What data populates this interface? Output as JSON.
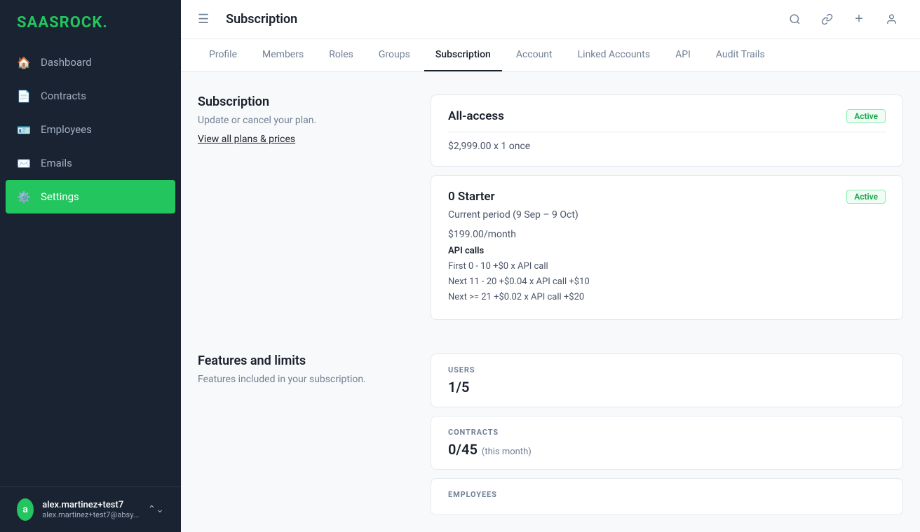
{
  "app": {
    "logo_text": "SAASROCK",
    "logo_dot": "."
  },
  "sidebar": {
    "items": [
      {
        "id": "dashboard",
        "label": "Dashboard",
        "icon": "🏠",
        "active": false
      },
      {
        "id": "contracts",
        "label": "Contracts",
        "icon": "📄",
        "active": false
      },
      {
        "id": "employees",
        "label": "Employees",
        "icon": "🪪",
        "active": false
      },
      {
        "id": "emails",
        "label": "Emails",
        "icon": "✉️",
        "active": false
      },
      {
        "id": "settings",
        "label": "Settings",
        "icon": "⚙️",
        "active": true
      }
    ],
    "user": {
      "avatar_letter": "a",
      "name": "alex.martinez+test7",
      "email": "alex.martinez+test7@absy..."
    }
  },
  "topbar": {
    "title": "Subscription",
    "search_icon": "🔍",
    "link_icon": "🔗",
    "add_icon": "+",
    "user_icon": "👤"
  },
  "tabs": [
    {
      "id": "profile",
      "label": "Profile",
      "active": false
    },
    {
      "id": "members",
      "label": "Members",
      "active": false
    },
    {
      "id": "roles",
      "label": "Roles",
      "active": false
    },
    {
      "id": "groups",
      "label": "Groups",
      "active": false
    },
    {
      "id": "subscription",
      "label": "Subscription",
      "active": true
    },
    {
      "id": "account",
      "label": "Account",
      "active": false
    },
    {
      "id": "linked-accounts",
      "label": "Linked Accounts",
      "active": false
    },
    {
      "id": "api",
      "label": "API",
      "active": false
    },
    {
      "id": "audit-trails",
      "label": "Audit Trails",
      "active": false
    }
  ],
  "subscription_section": {
    "heading": "Subscription",
    "description": "Update or cancel your plan.",
    "link_text": "View all plans & prices",
    "plans": [
      {
        "id": "all-access",
        "name": "All-access",
        "badge": "Active",
        "price_line": "$2,999.00 x 1 once"
      },
      {
        "id": "starter",
        "name": "0 Starter",
        "badge": "Active",
        "period": "Current period (9 Sep – 9 Oct)",
        "monthly": "$199.00/month",
        "api_calls_label": "API calls",
        "api_lines": [
          "First 0 - 10 +$0 x API call",
          "Next 11 - 20 +$0.04 x API call +$10",
          "Next >= 21 +$0.02 x API call +$20"
        ]
      }
    ]
  },
  "features_section": {
    "heading": "Features and limits",
    "description": "Features included in your subscription.",
    "items": [
      {
        "id": "users",
        "label": "USERS",
        "value": "1/5",
        "suffix": ""
      },
      {
        "id": "contracts",
        "label": "CONTRACTS",
        "value": "0/45",
        "suffix": "(this month)"
      },
      {
        "id": "employees",
        "label": "EMPLOYEES",
        "value": "",
        "suffix": ""
      }
    ]
  }
}
